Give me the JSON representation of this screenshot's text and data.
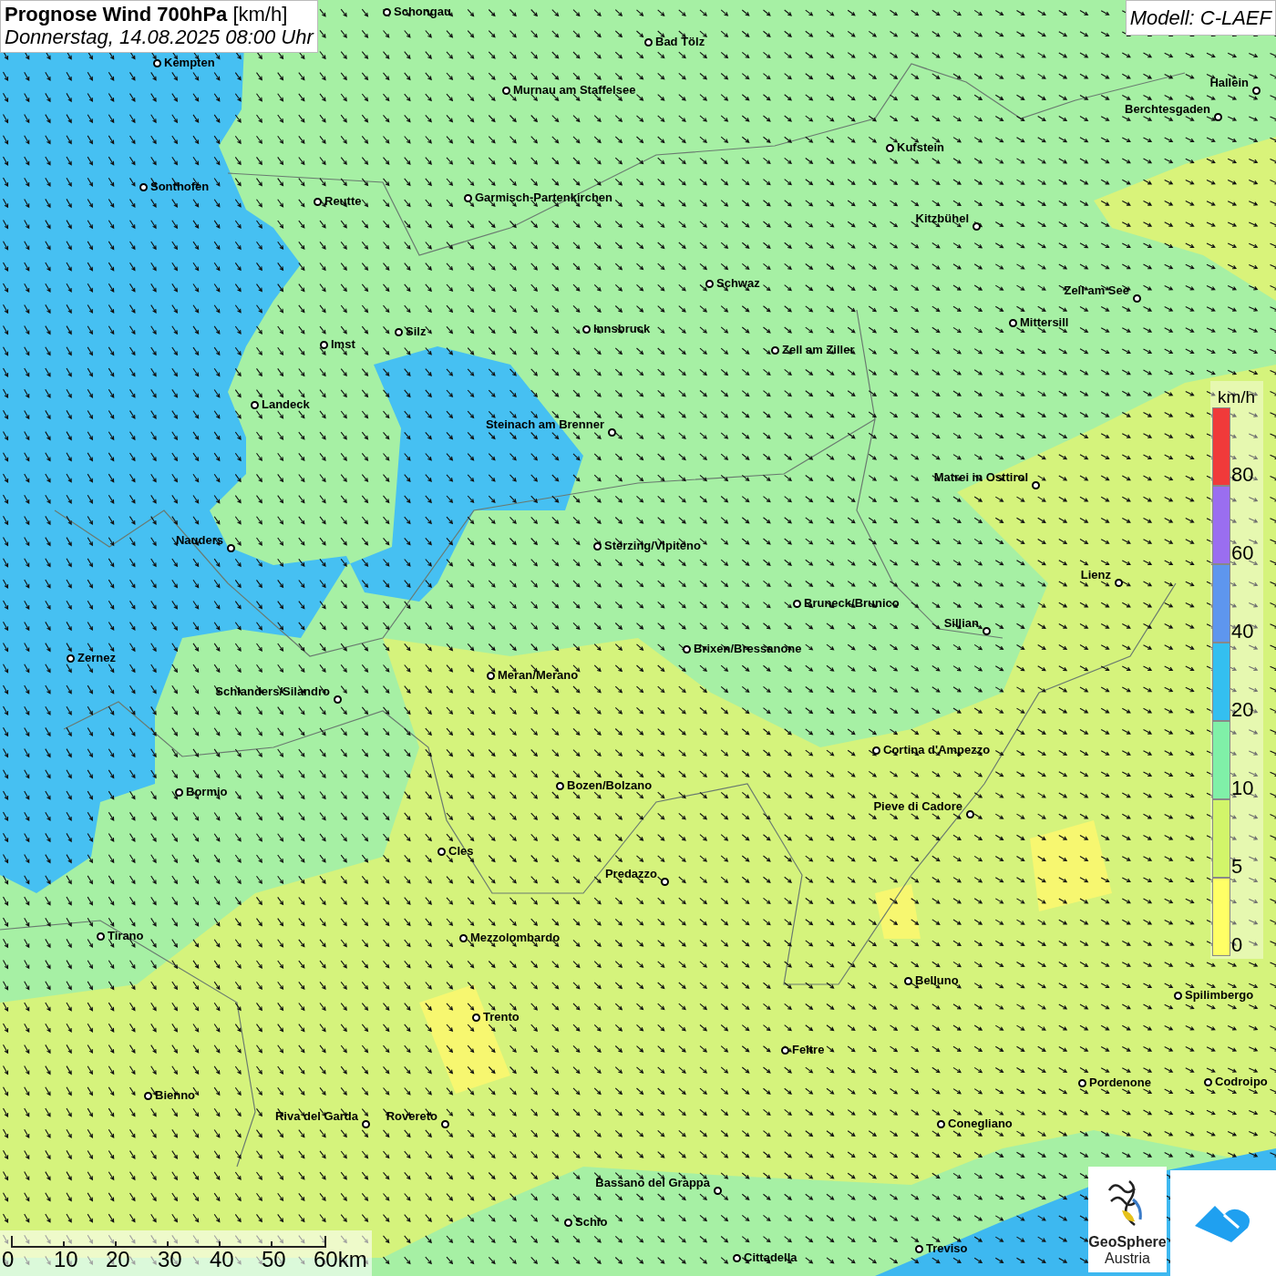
{
  "title": {
    "main": "**Prognose Wind 700hPa** [km/h]",
    "datetime": "Donnerstag, 14.08.2025 08:00 Uhr"
  },
  "model": "Modell: C-LAEF",
  "cities": [
    {
      "name": "Schongau"
    },
    {
      "name": "Bad Tölz"
    },
    {
      "name": "Kempten"
    },
    {
      "name": "Murnau am Staffelsee"
    },
    {
      "name": "Hallein"
    },
    {
      "name": "Berchtesgaden"
    },
    {
      "name": "Kufstein"
    },
    {
      "name": "Sonthofen"
    },
    {
      "name": "Reutte"
    },
    {
      "name": "Garmisch-Partenkirchen"
    },
    {
      "name": "Kitzbühel"
    },
    {
      "name": "Schwaz"
    },
    {
      "name": "Zell am See"
    },
    {
      "name": "Mittersill"
    },
    {
      "name": "Innsbruck"
    },
    {
      "name": "Silz"
    },
    {
      "name": "Imst"
    },
    {
      "name": "Zell am Ziller"
    },
    {
      "name": "Landeck"
    },
    {
      "name": "Steinach am Brenner"
    },
    {
      "name": "Matrei in Osttirol"
    },
    {
      "name": "Nauders"
    },
    {
      "name": "Sterzing/Vipiteno"
    },
    {
      "name": "Lienz"
    },
    {
      "name": "Bruneck/Brunico"
    },
    {
      "name": "Sillian"
    },
    {
      "name": "Brixen/Bressanone"
    },
    {
      "name": "Zernez"
    },
    {
      "name": "Meran/Merano"
    },
    {
      "name": "Schlanders/Silandro"
    },
    {
      "name": "Cortina d'Ampezzo"
    },
    {
      "name": "Bozen/Bolzano"
    },
    {
      "name": "Bormio"
    },
    {
      "name": "Pieve di Cadore"
    },
    {
      "name": "Cles"
    },
    {
      "name": "Predazzo"
    },
    {
      "name": "Tirano"
    },
    {
      "name": "Mezzolombardo"
    },
    {
      "name": "Belluno"
    },
    {
      "name": "Spilimbergo"
    },
    {
      "name": "Trento"
    },
    {
      "name": "Feltre"
    },
    {
      "name": "Pordenone"
    },
    {
      "name": "Codroipo"
    },
    {
      "name": "Bienno"
    },
    {
      "name": "Riva del Garda"
    },
    {
      "name": "Rovereto"
    },
    {
      "name": "Conegliano"
    },
    {
      "name": "Bassano del Grappa"
    },
    {
      "name": "Schio"
    },
    {
      "name": "Treviso"
    },
    {
      "name": "Cittadella"
    }
  ],
  "legend": {
    "unit": "km/h",
    "bands": [
      {
        "label": "80",
        "color": "#f03a3a"
      },
      {
        "label": "60",
        "color": "#9a6ef0"
      },
      {
        "label": "40",
        "color": "#5e96ee"
      },
      {
        "label": "20",
        "color": "#34bff0"
      },
      {
        "label": "10",
        "color": "#80f0a8"
      },
      {
        "label": "5",
        "color": "#d2f56a"
      },
      {
        "label": "0",
        "color": "#ffff66"
      }
    ]
  },
  "scale_bar": [
    "0",
    "10",
    "20",
    "30",
    "40",
    "50",
    "60km"
  ],
  "logo": {
    "line1": "GeoSphere",
    "line2": "Austria"
  }
}
